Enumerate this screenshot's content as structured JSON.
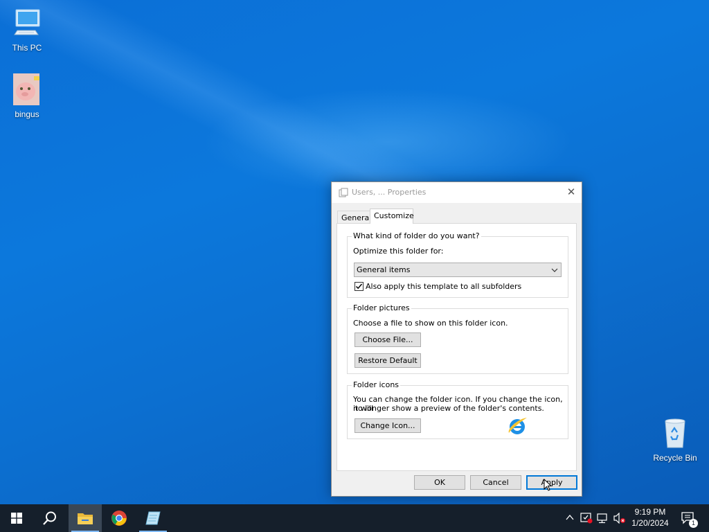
{
  "desktop": {
    "icons": [
      {
        "label": "This PC",
        "icon": "monitor-icon"
      },
      {
        "label": "bingus",
        "icon": "image-file-icon"
      },
      {
        "label": "Recycle Bin",
        "icon": "recycle-bin-icon"
      }
    ]
  },
  "dialog": {
    "title": "Users, ... Properties",
    "tabs": [
      {
        "label": "General"
      },
      {
        "label": "Customize"
      }
    ],
    "active_tab": "Customize",
    "kind_group": {
      "legend": "What kind of folder do you want?",
      "optimize_label": "Optimize this folder for:",
      "optimize_value": "General items",
      "apply_subfolders_label": "Also apply this template to all subfolders",
      "apply_subfolders_checked": true
    },
    "pictures_group": {
      "legend": "Folder pictures",
      "description": "Choose a file to show on this folder icon.",
      "choose_file_label": "Choose File...",
      "restore_default_label": "Restore Default"
    },
    "icons_group": {
      "legend": "Folder icons",
      "description_line1": "You can change the folder icon. If you change the icon, it will",
      "description_line2": "no longer show a preview of the folder's contents.",
      "change_icon_label": "Change Icon...",
      "preview_icon": "internet-explorer-icon"
    },
    "buttons": {
      "ok": "OK",
      "cancel": "Cancel",
      "apply": "Apply"
    }
  },
  "taskbar": {
    "items": [
      {
        "name": "start",
        "icon": "windows-logo-icon"
      },
      {
        "name": "search",
        "icon": "search-icon"
      },
      {
        "name": "file-explorer",
        "icon": "folder-icon",
        "active": true
      },
      {
        "name": "chrome",
        "icon": "chrome-icon"
      },
      {
        "name": "app",
        "icon": "notepad-icon"
      }
    ],
    "clock": {
      "time": "9:19 PM",
      "date": "1/20/2024"
    },
    "notification_count": "1"
  },
  "colors": {
    "accent": "#0078d7",
    "desktop": "#0c78dc",
    "taskbar": "#151f2b"
  }
}
